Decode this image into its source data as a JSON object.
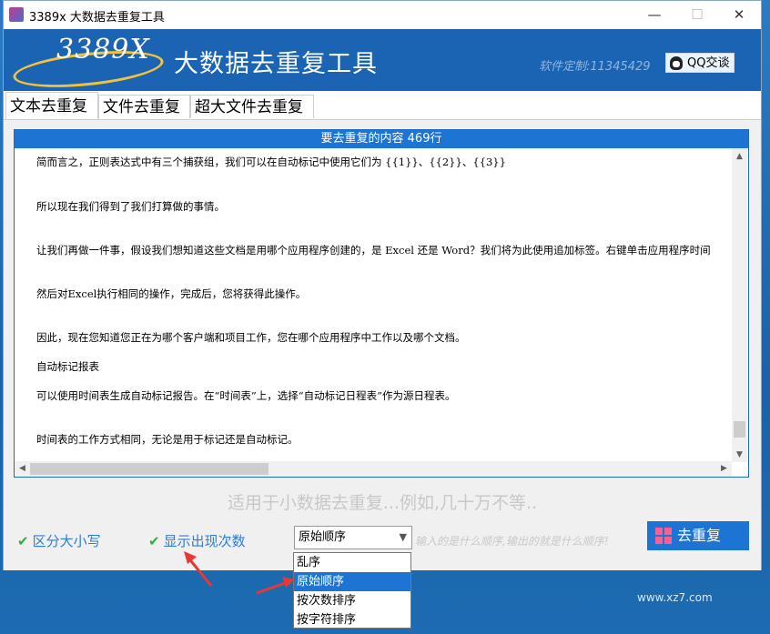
{
  "window": {
    "title": "3389x 大数据去重复工具",
    "minimize": "—",
    "maximize": "☐",
    "close": "✕"
  },
  "header": {
    "logo": "3389X",
    "app_name": "大数据去重复工具",
    "custom": "软件定制:11345429",
    "qq_label": "QQ交谈"
  },
  "tabs": [
    {
      "label": "文本去重复"
    },
    {
      "label": "文件去重复"
    },
    {
      "label": "超大文件去重复"
    }
  ],
  "content": {
    "header": "要去重复的内容  469行",
    "lines": [
      "简而言之，正则表达式中有三个捕获组，我们可以在自动标记中使用它们为 {{1}}、{{2}}、{{3}}",
      "所以现在我们得到了我们打算做的事情。",
      "让我们再做一件事，假设我们想知道这些文档是用哪个应用程序创建的，是 Excel 还是 Word？我们将为此使用追加标签。右键单击应用程序时间",
      "然后对Excel执行相同的操作，完成后，您将获得此操作。",
      "因此，现在您知道您正在为哪个客户端和项目工作，您在哪个应用程序中工作以及哪个文档。",
      "自动标记报表",
      "可以使用时间表生成自动标记报告。在“时间表”上，选择“自动标记日程表”作为源日程表。",
      "时间表的工作方式相同，无论是用于标记还是自动标记。"
    ]
  },
  "hint": "适用于小数据去重复...例如,几十万不等..",
  "options": {
    "case_sensitive": "区分大小写",
    "show_count": "显示出现次数",
    "tick": "✔"
  },
  "order_select": {
    "value": "原始顺序",
    "options": [
      "乱序",
      "原始顺序",
      "按次数排序",
      "按字符排序"
    ],
    "selected_index": 1
  },
  "note": "输入的是什么顺序,输出的就是什么顺序!",
  "dedupe_button": "去重复",
  "watermark": "www.xz7.com",
  "colors": {
    "accent": "#1d74d2",
    "header_bg": "#1b64b4",
    "check": "#3aaa3a",
    "annotation": "#e53935"
  }
}
